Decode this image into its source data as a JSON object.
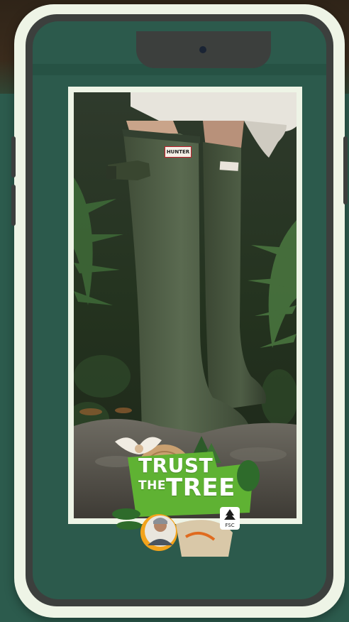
{
  "product": {
    "boot_brand_label": "HUNTER"
  },
  "badge": {
    "line1": "TRUST",
    "line2_small": "THE",
    "line2_large": "TREE",
    "certification_mark": "FSC"
  },
  "colors": {
    "background": "#2c5b4d",
    "phone_frame": "#eef4e6",
    "phone_bezel": "#3c3f3d",
    "screen": "#2c5a4c",
    "badge_green": "#5fb233",
    "boot_green": "#4e5d45",
    "sun_orange": "#f2a31c"
  },
  "icons": {
    "camera": "camera-dot-icon",
    "fsc_tree": "fsc-tree-icon",
    "owl": "owl-icon",
    "portrait": "person-portrait-icon"
  }
}
